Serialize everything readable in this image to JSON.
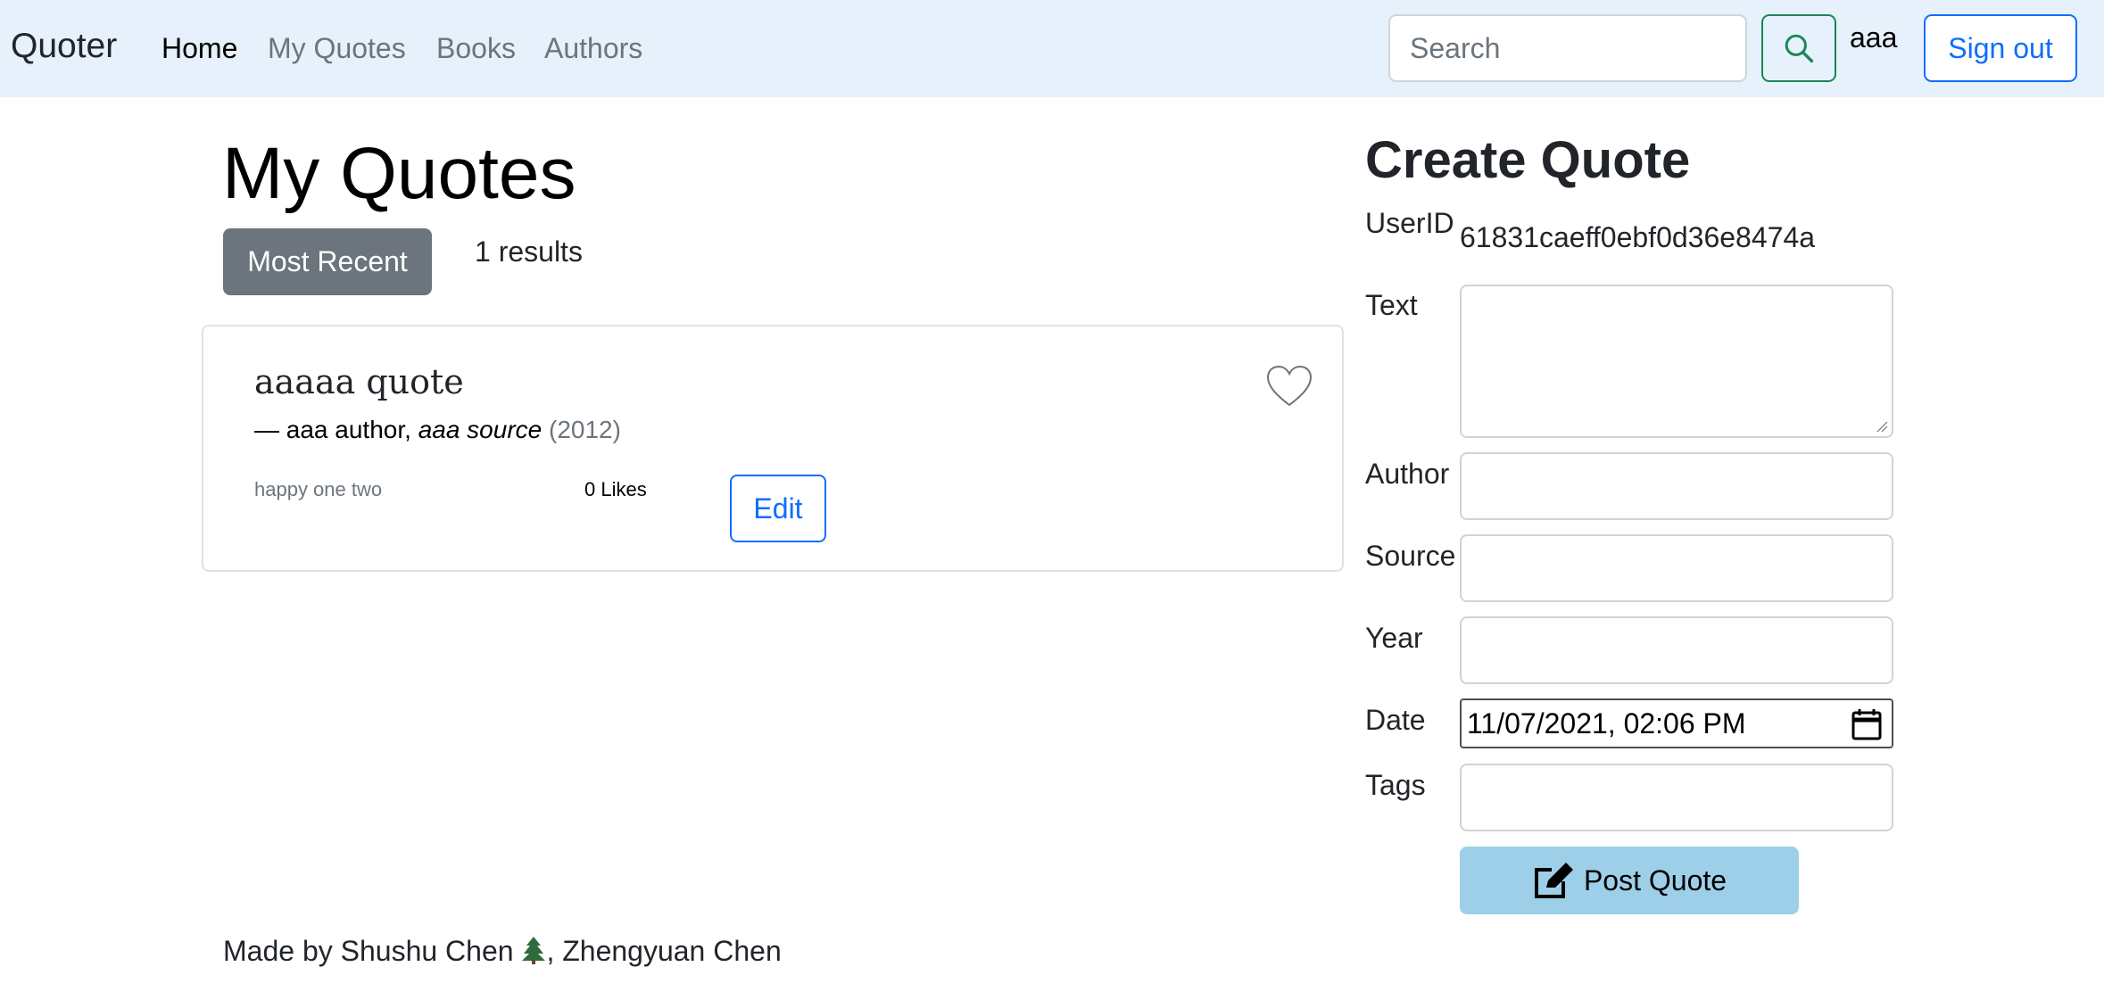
{
  "navbar": {
    "brand": "Quoter",
    "links": [
      "Home",
      "My Quotes",
      "Books",
      "Authors"
    ],
    "active_link": "Home",
    "search_placeholder": "Search",
    "search_icon": "search-icon",
    "username": "aaa",
    "signout_label": "Sign out"
  },
  "main": {
    "title": "My Quotes",
    "sort_button": "Most Recent",
    "results_text": "1 results",
    "quotes": [
      {
        "text": "aaaaa quote",
        "dash": "— ",
        "author": "aaa author",
        "separator": ", ",
        "source": "aaa source",
        "year": "(2012)",
        "tags": "happy one two",
        "likes": "0 Likes",
        "edit_label": "Edit",
        "like_icon": "heart-outline-icon"
      }
    ]
  },
  "create_form": {
    "title": "Create Quote",
    "userid_label": "UserID",
    "userid_value": "61831caeff0ebf0d36e8474a",
    "text_label": "Text",
    "author_label": "Author",
    "source_label": "Source",
    "year_label": "Year",
    "date_label": "Date",
    "date_value": "11/07/2021, 02:06  PM",
    "tags_label": "Tags",
    "post_label": "Post Quote",
    "post_icon": "edit-pen-icon"
  },
  "footer": {
    "prefix": "Made by Shushu Chen ",
    "suffix": ", Zhengyuan Chen",
    "tree_icon": "tree-icon"
  },
  "colors": {
    "navbar_bg": "#e7f1fb",
    "primary": "#0d6efd",
    "success": "#198754",
    "secondary": "#6c757d",
    "post_button_bg": "#9ecfe9"
  }
}
